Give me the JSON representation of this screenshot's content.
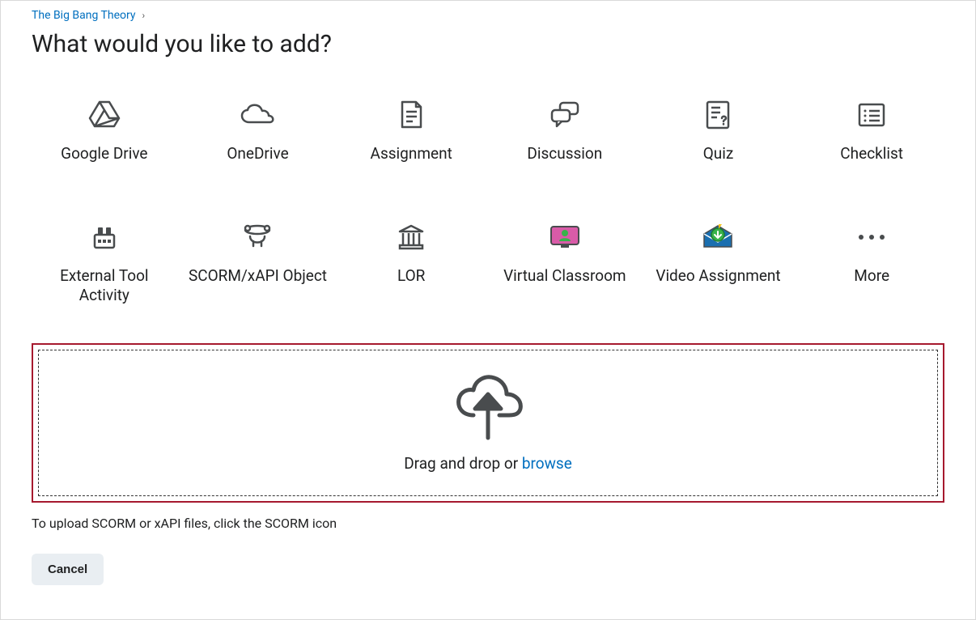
{
  "breadcrumb": {
    "course": "The Big Bang Theory"
  },
  "title": "What would you like to add?",
  "grid": {
    "google_drive": "Google Drive",
    "onedrive": "OneDrive",
    "assignment": "Assignment",
    "discussion": "Discussion",
    "quiz": "Quiz",
    "checklist": "Checklist",
    "external_tool": "External Tool Activity",
    "scorm": "SCORM/xAPI Object",
    "lor": "LOR",
    "virtual_classroom": "Virtual Classroom",
    "video_assignment": "Video Assignment",
    "more": "More"
  },
  "dropzone": {
    "prefix": "Drag and drop or ",
    "browse": "browse"
  },
  "helper": "To upload SCORM or xAPI files, click the SCORM icon",
  "cancel": "Cancel"
}
